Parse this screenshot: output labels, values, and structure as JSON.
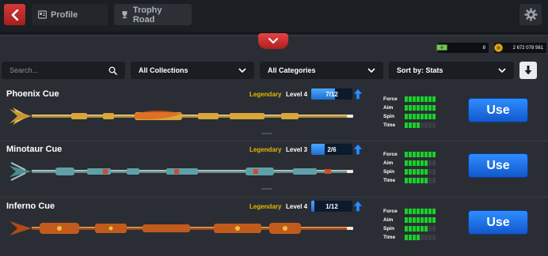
{
  "nav": {
    "profile_label": "Profile",
    "trophy_road_label": "Trophy Road"
  },
  "currency": {
    "cash": "8",
    "coins": "2 672 078 561"
  },
  "filters": {
    "search_placeholder": "Search...",
    "collections": "All Collections",
    "categories": "All Categories",
    "sort": "Sort by: Stats"
  },
  "cues": [
    {
      "name": "Phoenix Cue",
      "rarity": "Legendary",
      "level": "Level 4",
      "progress_text": "7/12",
      "progress": 0.58,
      "use_label": "Use",
      "stats": [
        {
          "label": "Force",
          "value": 8
        },
        {
          "label": "Aim",
          "value": 8
        },
        {
          "label": "Spin",
          "value": 8
        },
        {
          "label": "Time",
          "value": 4
        }
      ]
    },
    {
      "name": "Minotaur Cue",
      "rarity": "Legendary",
      "level": "Level 3",
      "progress_text": "2/6",
      "progress": 0.33,
      "use_label": "Use",
      "stats": [
        {
          "label": "Force",
          "value": 8
        },
        {
          "label": "Aim",
          "value": 6
        },
        {
          "label": "Spin",
          "value": 6
        },
        {
          "label": "Time",
          "value": 6
        }
      ]
    },
    {
      "name": "Inferno Cue",
      "rarity": "Legendary",
      "level": "Level 4",
      "progress_text": "1/12",
      "progress": 0.08,
      "use_label": "Use",
      "stats": [
        {
          "label": "Force",
          "value": 8
        },
        {
          "label": "Aim",
          "value": 8
        },
        {
          "label": "Spin",
          "value": 6
        },
        {
          "label": "Time",
          "value": 4
        }
      ]
    }
  ],
  "colors": {
    "accent_red": "#d33a3a",
    "legendary": "#e6b800",
    "button_blue": "#1f6fd1",
    "stat_green": "#19d12a"
  },
  "icons": {
    "back": "chevron-left-icon",
    "profile": "id-card-icon",
    "trophy": "trophy-icon",
    "settings": "gear-icon",
    "search": "search-icon",
    "dropdown": "chevron-down-icon",
    "sort_direction": "arrow-down-icon",
    "upgrade": "arrow-up-icon"
  }
}
